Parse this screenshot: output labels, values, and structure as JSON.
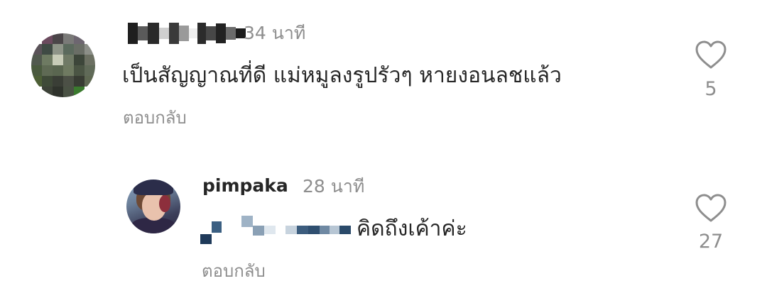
{
  "comments": [
    {
      "timestamp": "34 นาที",
      "text": "เป็นสัญญาณที่ดี แม่หมูลงรูปรัวๆ หายงอนลชแล้ว",
      "reply_label": "ตอบกลับ",
      "like_icon": "heart-outline-icon",
      "likes": "5"
    }
  ],
  "reply": {
    "username": "pimpaka",
    "timestamp": "28 นาที",
    "text": "คิดถึงเค้าค่ะ",
    "reply_label": "ตอบกลับ",
    "like_icon": "heart-outline-icon",
    "likes": "27"
  },
  "colors": {
    "text": "#262626",
    "secondary": "#8e8e8e",
    "background": "#ffffff"
  }
}
